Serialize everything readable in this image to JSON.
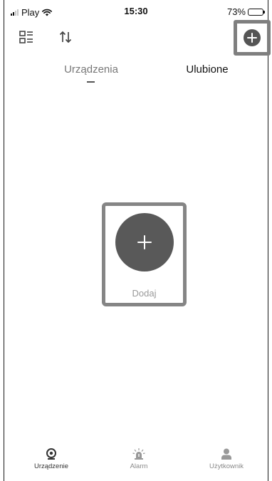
{
  "status_bar": {
    "carrier": "Play",
    "time": "15:30",
    "battery": "73%",
    "battery_level": 0.73
  },
  "toolbar": {
    "list_view_icon": "list-view-icon",
    "sort_icon": "sort-icon",
    "add_icon": "plus-circle-icon"
  },
  "tabs": [
    {
      "label": "Urządzenia",
      "active": true
    },
    {
      "label": "Ulubione",
      "active": false
    }
  ],
  "main": {
    "add_label": "Dodaj"
  },
  "bottom_nav": {
    "items": [
      {
        "label": "Urządzenie",
        "icon": "camera-icon",
        "active": true
      },
      {
        "label": "Alarm",
        "icon": "siren-icon",
        "active": false
      },
      {
        "label": "Użytkownik",
        "icon": "user-icon",
        "active": false
      }
    ]
  },
  "colors": {
    "highlight_border": "#7f7f7f",
    "add_button": "#595959",
    "inactive_text": "#8a8a8a"
  }
}
